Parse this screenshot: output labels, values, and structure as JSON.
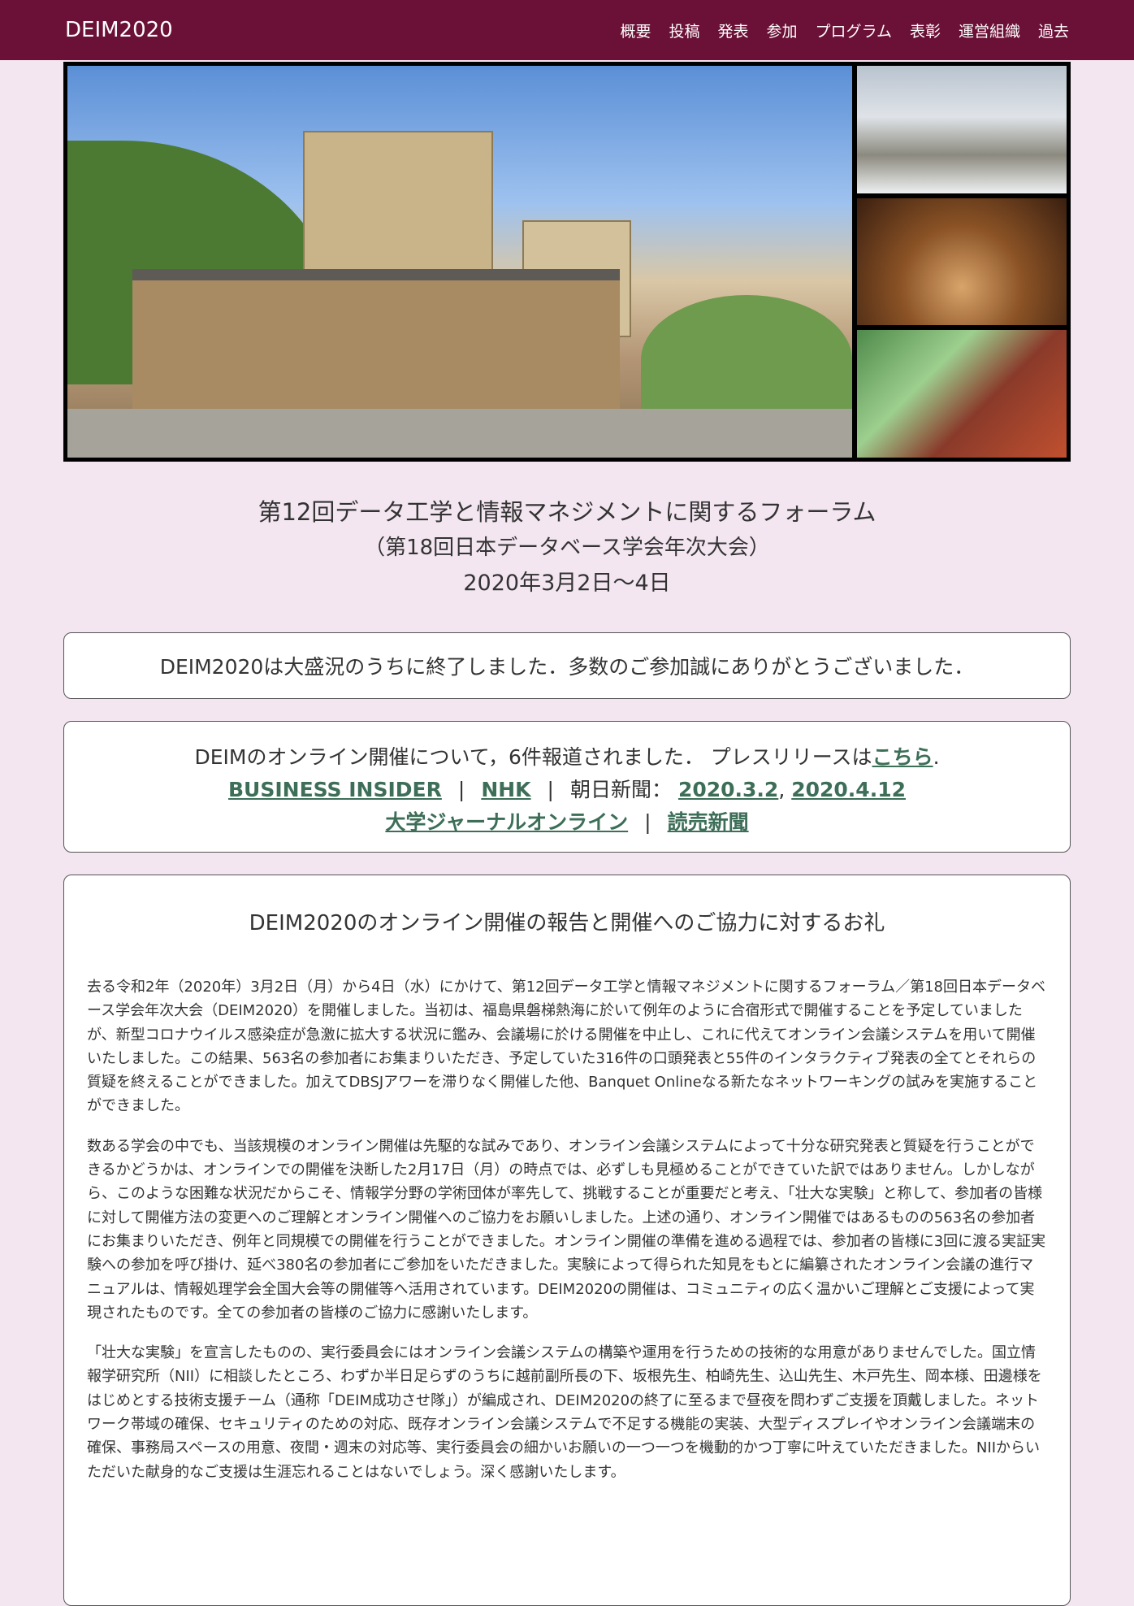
{
  "nav": {
    "brand": "DEIM2020",
    "items": [
      "概要",
      "投稿",
      "発表",
      "参加",
      "プログラム",
      "表彰",
      "運営組織",
      "過去"
    ]
  },
  "header": {
    "title_line1": "第12回データ工学と情報マネジメントに関するフォーラム",
    "title_line2": "（第18回日本データベース学会年次大会）",
    "dates": "2020年3月2日〜4日"
  },
  "notice": {
    "ended": "DEIM2020は大盛況のうちに終了しました．多数のご参加誠にありがとうございました．"
  },
  "press": {
    "line1_text": "DEIMのオンライン開催について，6件報道されました． プレスリリースは",
    "line1_link": "こちら",
    "line1_end": ".",
    "business_insider": "BUSINESS INSIDER",
    "nhk": "NHK",
    "asahi_label": "朝日新聞：",
    "asahi_link1": "2020.3.2",
    "comma": ",",
    "asahi_link2": "2020.4.12",
    "daigaku": "大学ジャーナルオンライン",
    "yomiuri": "読売新聞",
    "separator": "|"
  },
  "report": {
    "heading": "DEIM2020のオンライン開催の報告と開催へのご協力に対するお礼",
    "p1": "去る令和2年（2020年）3月2日（月）から4日（水）にかけて、第12回データ工学と情報マネジメントに関するフォーラム／第18回日本データベース学会年次大会（DEIM2020）を開催しました。当初は、福島県磐梯熱海に於いて例年のように合宿形式で開催することを予定していましたが、新型コロナウイルス感染症が急激に拡大する状況に鑑み、会議場に於ける開催を中止し、これに代えてオンライン会議システムを用いて開催いたしました。この結果、563名の参加者にお集まりいただき、予定していた316件の口頭発表と55件のインタラクティブ発表の全てとそれらの質疑を終えることができました。加えてDBSJアワーを滞りなく開催した他、Banquet Onlineなる新たなネットワーキングの試みを実施することができました。",
    "p2": "数ある学会の中でも、当該規模のオンライン開催は先駆的な試みであり、オンライン会議システムによって十分な研究発表と質疑を行うことができるかどうかは、オンラインでの開催を決断した2月17日（月）の時点では、必ずしも見極めることができていた訳ではありません。しかしながら、このような困難な状況だからこそ、情報学分野の学術団体が率先して、挑戦することが重要だと考え、「壮大な実験」と称して、参加者の皆様に対して開催方法の変更へのご理解とオンライン開催へのご協力をお願いしました。上述の通り、オンライン開催ではあるものの563名の参加者にお集まりいただき、例年と同規模での開催を行うことができました。オンライン開催の準備を進める過程では、参加者の皆様に3回に渡る実証実験への参加を呼び掛け、延べ380名の参加者にご参加をいただきました。実験によって得られた知見をもとに編纂されたオンライン会議の進行マニュアルは、情報処理学会全国大会等の開催等へ活用されています。DEIM2020の開催は、コミュニティの広く温かいご理解とご支援によって実現されたものです。全ての参加者の皆様のご協力に感謝いたします。",
    "p3": "「壮大な実験」を宣言したものの、実行委員会にはオンライン会議システムの構築や運用を行うための技術的な用意がありませんでした。国立情報学研究所（NII）に相談したところ、わずか半日足らずのうちに越前副所長の下、坂根先生、柏崎先生、込山先生、木戸先生、岡本様、田邊様をはじめとする技術支援チーム（通称「DEIM成功させ隊」）が編成され、DEIM2020の終了に至るまで昼夜を問わずご支援を頂戴しました。ネットワーク帯域の確保、セキュリティのための対応、既存オンライン会議システムで不足する機能の実装、大型ディスプレイやオンライン会議端末の確保、事務局スペースの用意、夜間・週末の対応等、実行委員会の細かいお願いの一つ一つを機動的かつ丁寧に叶えていただきました。NIIからいただいた献身的なご支援は生涯忘れることはないでしょう。深く感謝いたします。"
  },
  "colors": {
    "navbar": "#6b1036",
    "background": "#f3e6f0",
    "link": "#3d6e58"
  }
}
